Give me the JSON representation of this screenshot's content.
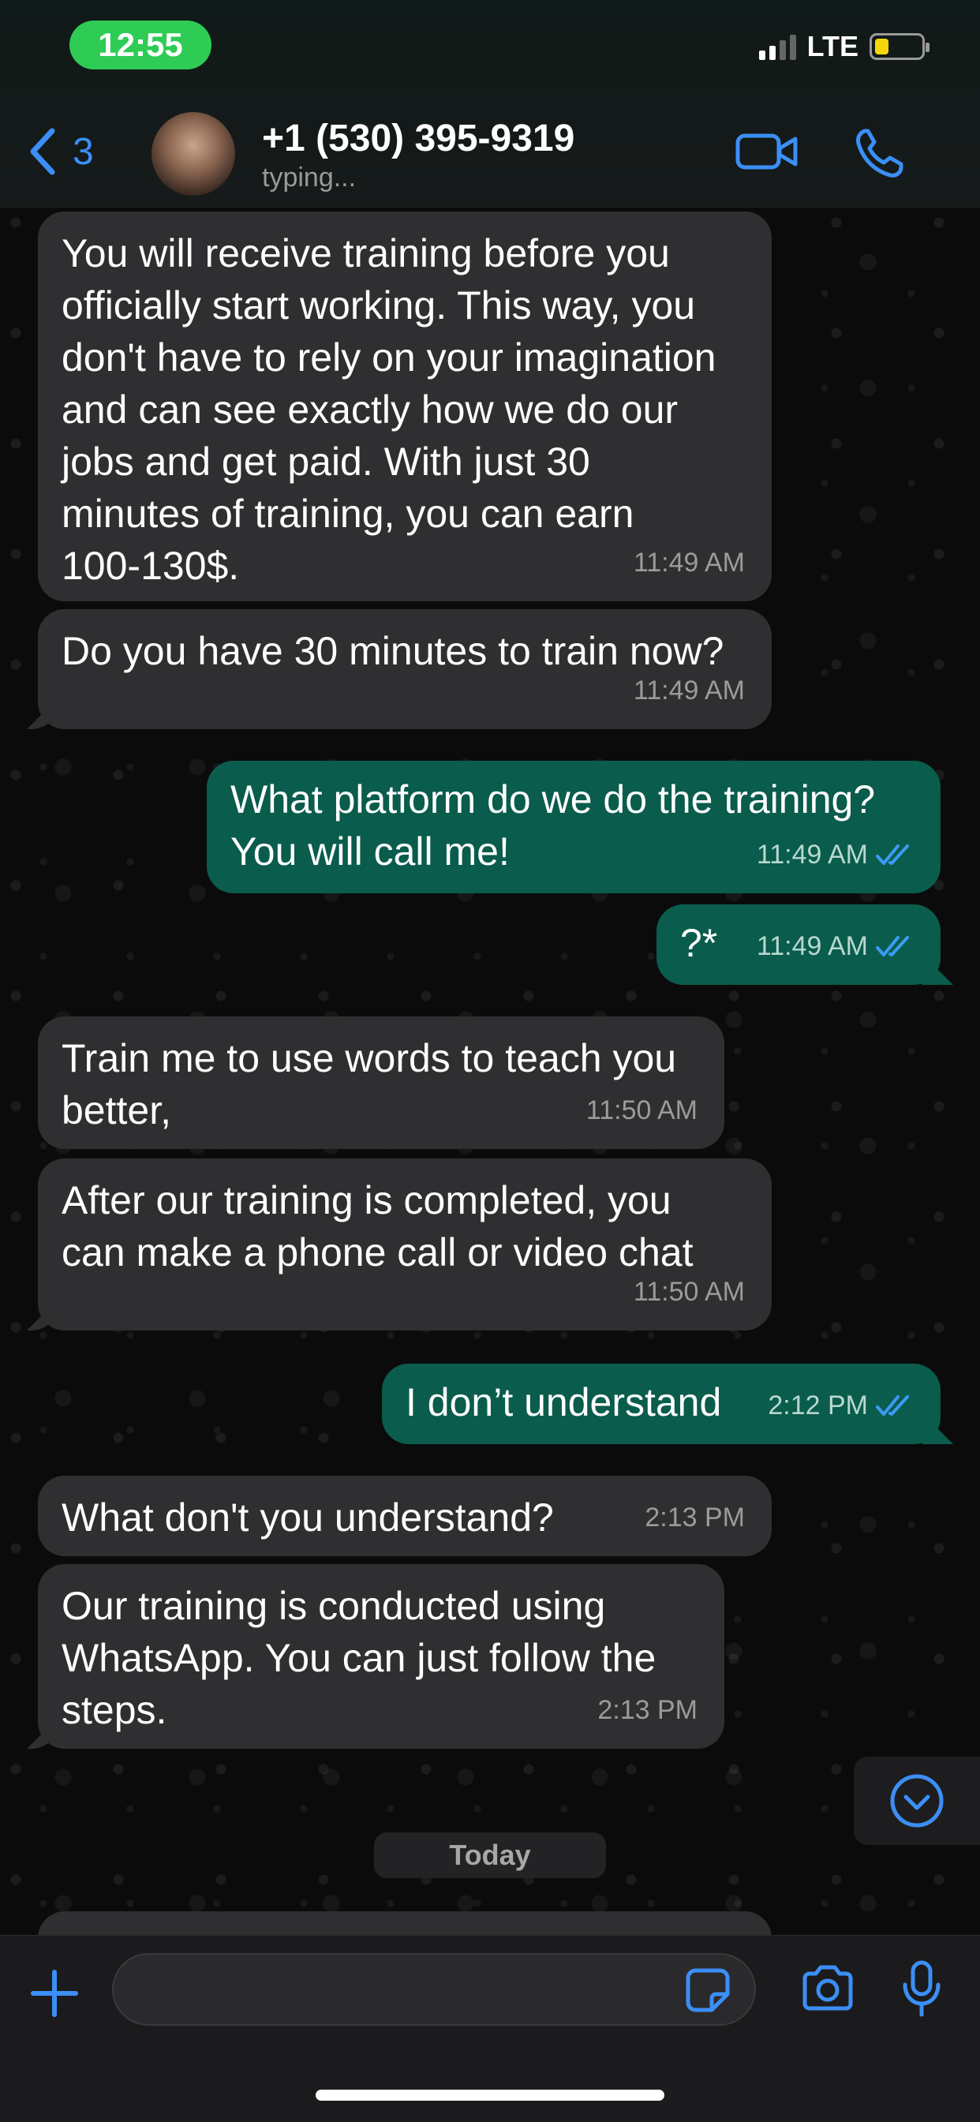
{
  "status_bar": {
    "time": "12:55",
    "network": "LTE",
    "signal_bars": 2,
    "battery_level": 0.3
  },
  "header": {
    "back_count": "3",
    "contact_name": "+1 (530) 395-9319",
    "contact_status": "typing..."
  },
  "messages": [
    {
      "direction": "incoming",
      "text": "You will receive training before you\nofficially start working. This way, you\ndon't have to rely on your imagination\nand can see exactly how we do our\njobs and get paid. With just 30\nminutes of training, you can earn\n100-130$.",
      "time": "11:49 AM"
    },
    {
      "direction": "incoming",
      "text": "Do you have 30 minutes to train now?",
      "time": "11:49 AM"
    },
    {
      "direction": "outgoing",
      "text": "What platform do we do the training?\nYou will call me!",
      "time": "11:49 AM",
      "read": true
    },
    {
      "direction": "outgoing",
      "text": "?*",
      "time": "11:49 AM",
      "read": true
    },
    {
      "direction": "incoming",
      "text": "Train me to use words to teach you\nbetter,",
      "time": "11:50 AM"
    },
    {
      "direction": "incoming",
      "text": "After our training is completed, you\ncan make a phone call or video chat",
      "time": "11:50 AM"
    },
    {
      "direction": "outgoing",
      "text": "I don’t understand",
      "time": "2:12 PM",
      "read": true
    },
    {
      "direction": "incoming",
      "text": "What don't you understand?",
      "time": "2:13 PM"
    },
    {
      "direction": "incoming",
      "text": "Our training is conducted using\nWhatsApp. You can just follow the\nsteps.",
      "time": "2:13 PM"
    }
  ],
  "date_separator": "Today",
  "input": {
    "value": "",
    "placeholder": ""
  },
  "colors": {
    "accent": "#3b8ff6",
    "incoming_bubble": "#2f2f31",
    "outgoing_bubble": "#0a5c4c",
    "time_pill": "#2ecc55",
    "battery": "#f5d60b"
  },
  "icons": [
    "back-chevron-icon",
    "video-call-icon",
    "phone-icon",
    "scroll-down-icon",
    "plus-icon",
    "sticker-icon",
    "camera-icon",
    "microphone-icon",
    "read-ticks-icon"
  ]
}
